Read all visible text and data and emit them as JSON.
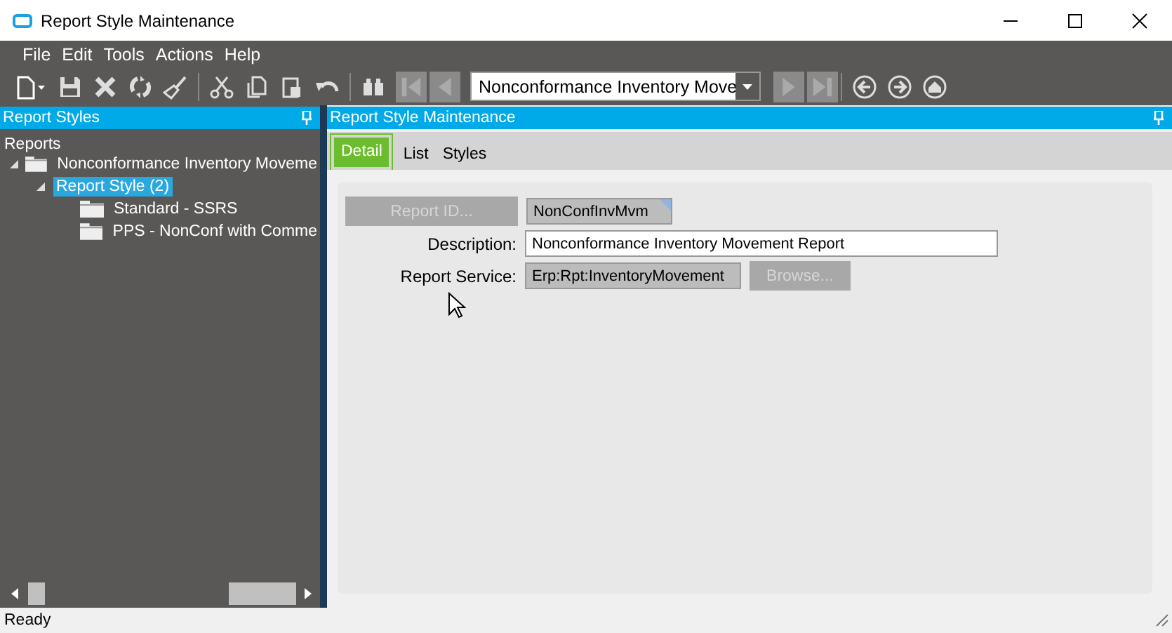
{
  "window": {
    "title": "Report Style Maintenance"
  },
  "menu": [
    "File",
    "Edit",
    "Tools",
    "Actions",
    "Help"
  ],
  "toolbar": {
    "record_combo": "Nonconformance Inventory Move",
    "nav": [
      {
        "kind": "first",
        "disabled": true
      },
      {
        "kind": "prev",
        "disabled": true
      },
      {
        "kind": "next",
        "disabled": true
      },
      {
        "kind": "last",
        "disabled": true
      }
    ]
  },
  "left_panel": {
    "title": "Report Styles",
    "tree": [
      {
        "label": "Reports",
        "children": [
          {
            "label": "Nonconformance Inventory Moveme",
            "expanded": true,
            "selected": false,
            "children": [
              {
                "label": "Report Style (2)",
                "expanded": true,
                "selected": true,
                "children": [
                  {
                    "label": "Standard - SSRS",
                    "selected": false
                  },
                  {
                    "label": "PPS - NonConf with Comme",
                    "selected": false
                  }
                ]
              }
            ]
          }
        ]
      }
    ]
  },
  "main_panel": {
    "title": "Report Style Maintenance",
    "tabs": [
      {
        "label": "Detail",
        "selected": true
      },
      {
        "label": "List",
        "selected": false
      },
      {
        "label": "Styles",
        "selected": false
      }
    ],
    "report_id": {
      "button": "Report ID...",
      "disabled": true,
      "value": "NonConfInvMvm"
    },
    "description": {
      "label": "Description:",
      "value": "Nonconformance Inventory Movement Report"
    },
    "report_service": {
      "label": "Report Service:",
      "value": "Erp:Rpt:InventoryMovement",
      "browse": "Browse...",
      "browse_disabled": true
    }
  },
  "status_bar": "Ready"
}
